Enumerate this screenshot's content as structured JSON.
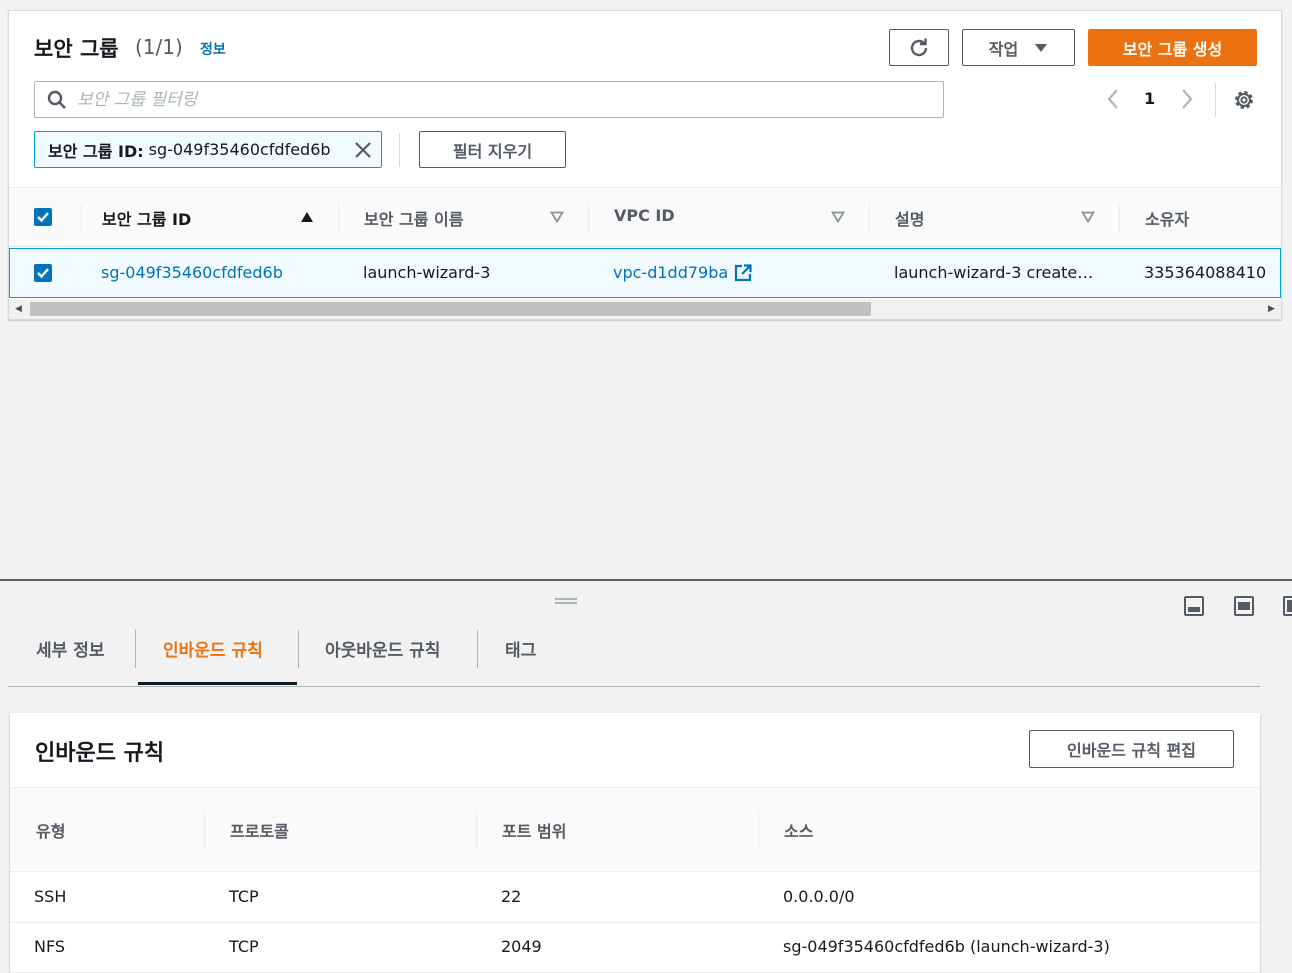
{
  "header": {
    "title": "보안 그룹",
    "count": "(1/1)",
    "info_link": "정보",
    "action_label": "작업",
    "create_label": "보안 그룹 생성"
  },
  "search": {
    "placeholder": "보안 그룹 필터링",
    "value": ""
  },
  "pagination": {
    "current_page": "1"
  },
  "filter_token": {
    "key": "보안 그룹 ID:",
    "value": "sg-049f35460cfdfed6b"
  },
  "clear_filters_label": "필터 지우기",
  "table": {
    "columns": [
      "보안 그룹 ID",
      "보안 그룹 이름",
      "VPC ID",
      "설명",
      "소유자"
    ],
    "rows": [
      {
        "selected": true,
        "sg_id": "sg-049f35460cfdfed6b",
        "name": "launch-wizard-3",
        "vpc_id": "vpc-d1dd79ba",
        "description": "launch-wizard-3 create…",
        "owner": "335364088410"
      }
    ]
  },
  "tabs": [
    {
      "label": "세부 정보",
      "active": false
    },
    {
      "label": "인바운드 규칙",
      "active": true
    },
    {
      "label": "아웃바운드 규칙",
      "active": false
    },
    {
      "label": "태그",
      "active": false
    }
  ],
  "inbound": {
    "title": "인바운드 규칙",
    "edit_label": "인바운드 규칙 편집",
    "columns": [
      "유형",
      "프로토콜",
      "포트 범위",
      "소스"
    ],
    "rows": [
      {
        "type": "SSH",
        "protocol": "TCP",
        "port": "22",
        "source": "0.0.0.0/0"
      },
      {
        "type": "NFS",
        "protocol": "TCP",
        "port": "2049",
        "source": "sg-049f35460cfdfed6b (launch-wizard-3)"
      }
    ]
  },
  "colors": {
    "primary": "#ec7211",
    "link": "#0073bb",
    "selected_bg": "#f1faff",
    "selected_border": "#00a1c9"
  }
}
